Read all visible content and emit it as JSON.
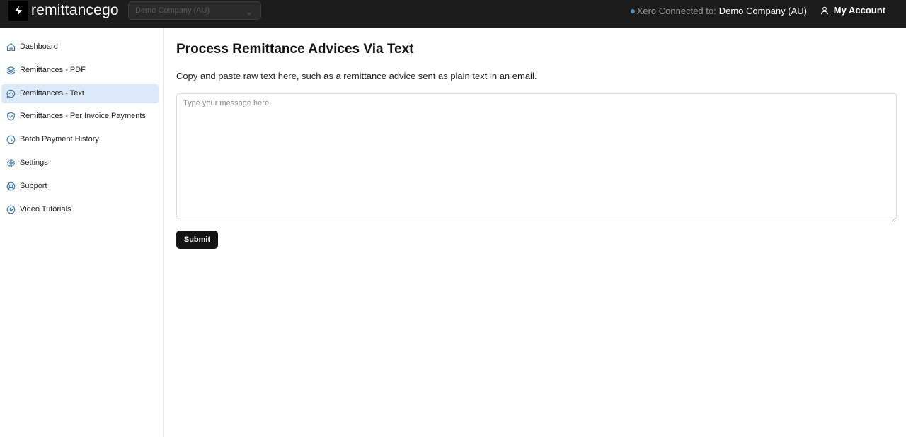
{
  "app": {
    "logo_text": "remittancego",
    "company_selector": {
      "value": "Demo Company (AU)"
    },
    "connection": {
      "label": "Xero Connected to:",
      "company": "Demo Company (AU)"
    },
    "account_label": "My Account"
  },
  "sidebar": {
    "items": [
      {
        "label": "Dashboard",
        "icon": "home-icon",
        "active": false
      },
      {
        "label": "Remittances - PDF",
        "icon": "layers-icon",
        "active": false
      },
      {
        "label": "Remittances - Text",
        "icon": "message-circle-icon",
        "active": true
      },
      {
        "label": "Remittances - Per Invoice Payments",
        "icon": "shield-check-icon",
        "active": false
      },
      {
        "label": "Batch Payment History",
        "icon": "clock-icon",
        "active": false
      },
      {
        "label": "Settings",
        "icon": "gear-icon",
        "active": false
      },
      {
        "label": "Support",
        "icon": "lifebuoy-icon",
        "active": false
      },
      {
        "label": "Video Tutorials",
        "icon": "play-circle-icon",
        "active": false
      }
    ]
  },
  "main": {
    "title": "Process Remittance Advices Via Text",
    "description": "Copy and paste raw text here, such as a remittance advice sent as plain text in an email.",
    "message_input": {
      "placeholder": "Type your message here.",
      "value": ""
    },
    "submit_label": "Submit"
  },
  "colors": {
    "topbar_bg": "#1c1c1c",
    "active_nav_bg": "#dbe9f8",
    "icon_blue": "#2f6fb0",
    "connected_dot": "#4a90c6",
    "submit_bg": "#141414"
  }
}
